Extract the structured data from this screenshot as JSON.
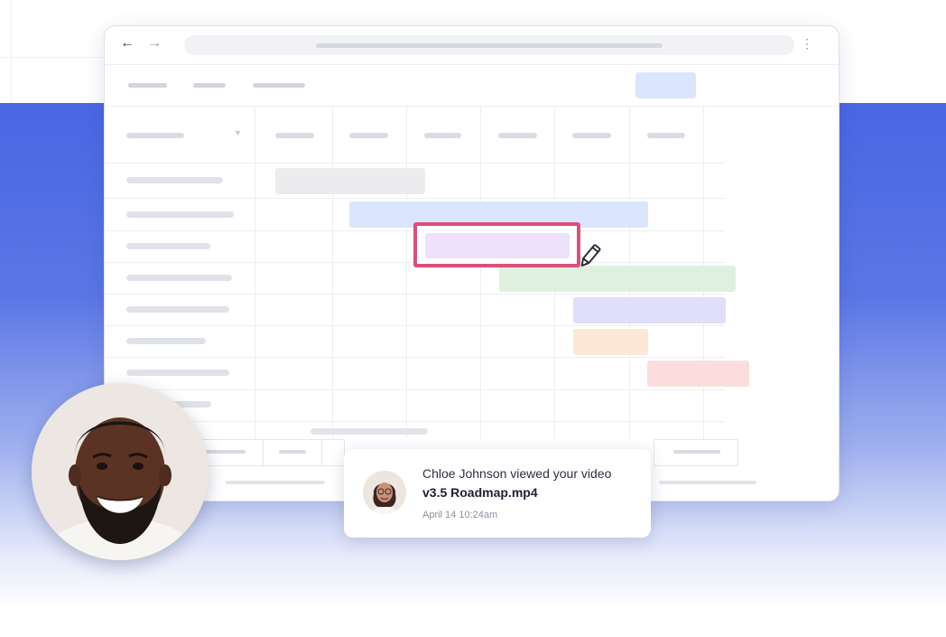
{
  "browser": {
    "back_icon": "←",
    "forward_icon": "→",
    "menu_icon": "⋮"
  },
  "gantt": {
    "bar_colors": [
      "#ececef",
      "#dbe5fd",
      "#ede1fb",
      "#dff0df",
      "#e0defb",
      "#fde7d6",
      "#fbdddd"
    ],
    "highlight_color": "#dc4f7c"
  },
  "notification": {
    "message_prefix": "Chloe Johnson viewed your video ",
    "file_name": "v3.5 Roadmap.mp4",
    "timestamp": "April 14 10:24am"
  }
}
